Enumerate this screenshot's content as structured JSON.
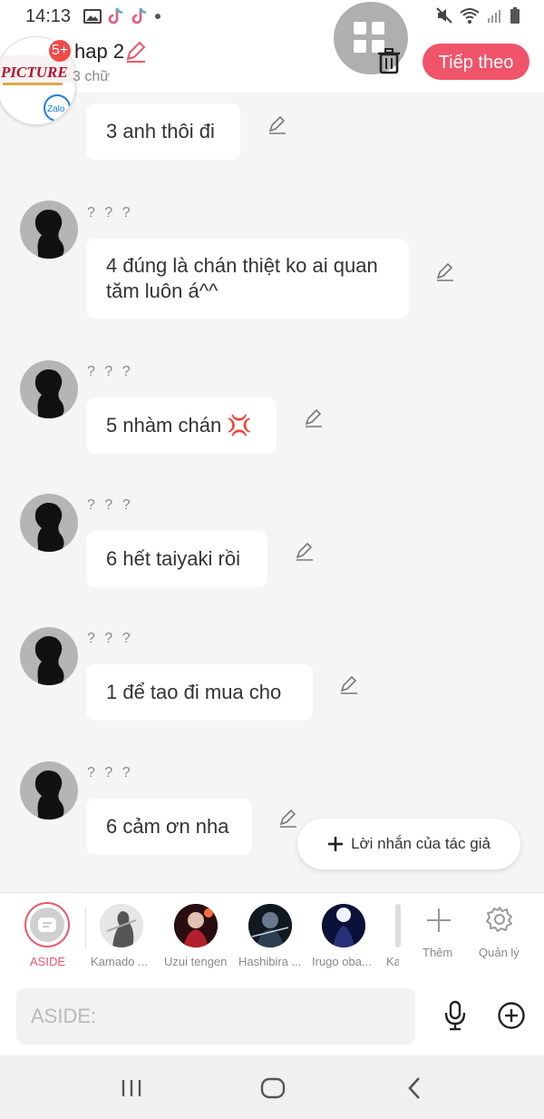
{
  "status_bar": {
    "time": "14:13"
  },
  "header": {
    "badge": "5+",
    "title": "hap 2",
    "word_count": "3 chữ",
    "next_button": "Tiếp theo",
    "avatar_brand_text": "PICTURE",
    "avatar_app_label": "Zalo"
  },
  "messages": [
    {
      "name": "",
      "text": "3 anh thôi đi"
    },
    {
      "name": "? ? ?",
      "text": "4 đúng là chán thiệt ko ai quan tăm luôn á^^"
    },
    {
      "name": "? ? ?",
      "text": "5 nhàm chán 💢"
    },
    {
      "name": "? ? ?",
      "text": "6 hết taiyaki rồi"
    },
    {
      "name": "? ? ?",
      "text": "1 để tao đi mua cho"
    },
    {
      "name": "? ? ?",
      "text": "6 cảm ơn nha"
    }
  ],
  "author_note_button": "Lời nhắn của tác giả",
  "characters": {
    "aside_label": "ASIDE",
    "items": [
      {
        "name": "Kamado ..."
      },
      {
        "name": "Uzui tengen"
      },
      {
        "name": "Hashibira ..."
      },
      {
        "name": "Irugo oba..."
      },
      {
        "name": "Ka"
      }
    ],
    "add_label": "Thêm",
    "manage_label": "Quản lý"
  },
  "input": {
    "placeholder": "ASIDE:"
  },
  "colors": {
    "accent": "#f0546a",
    "bubble": "#ffffff",
    "background": "#f5f5f5"
  }
}
